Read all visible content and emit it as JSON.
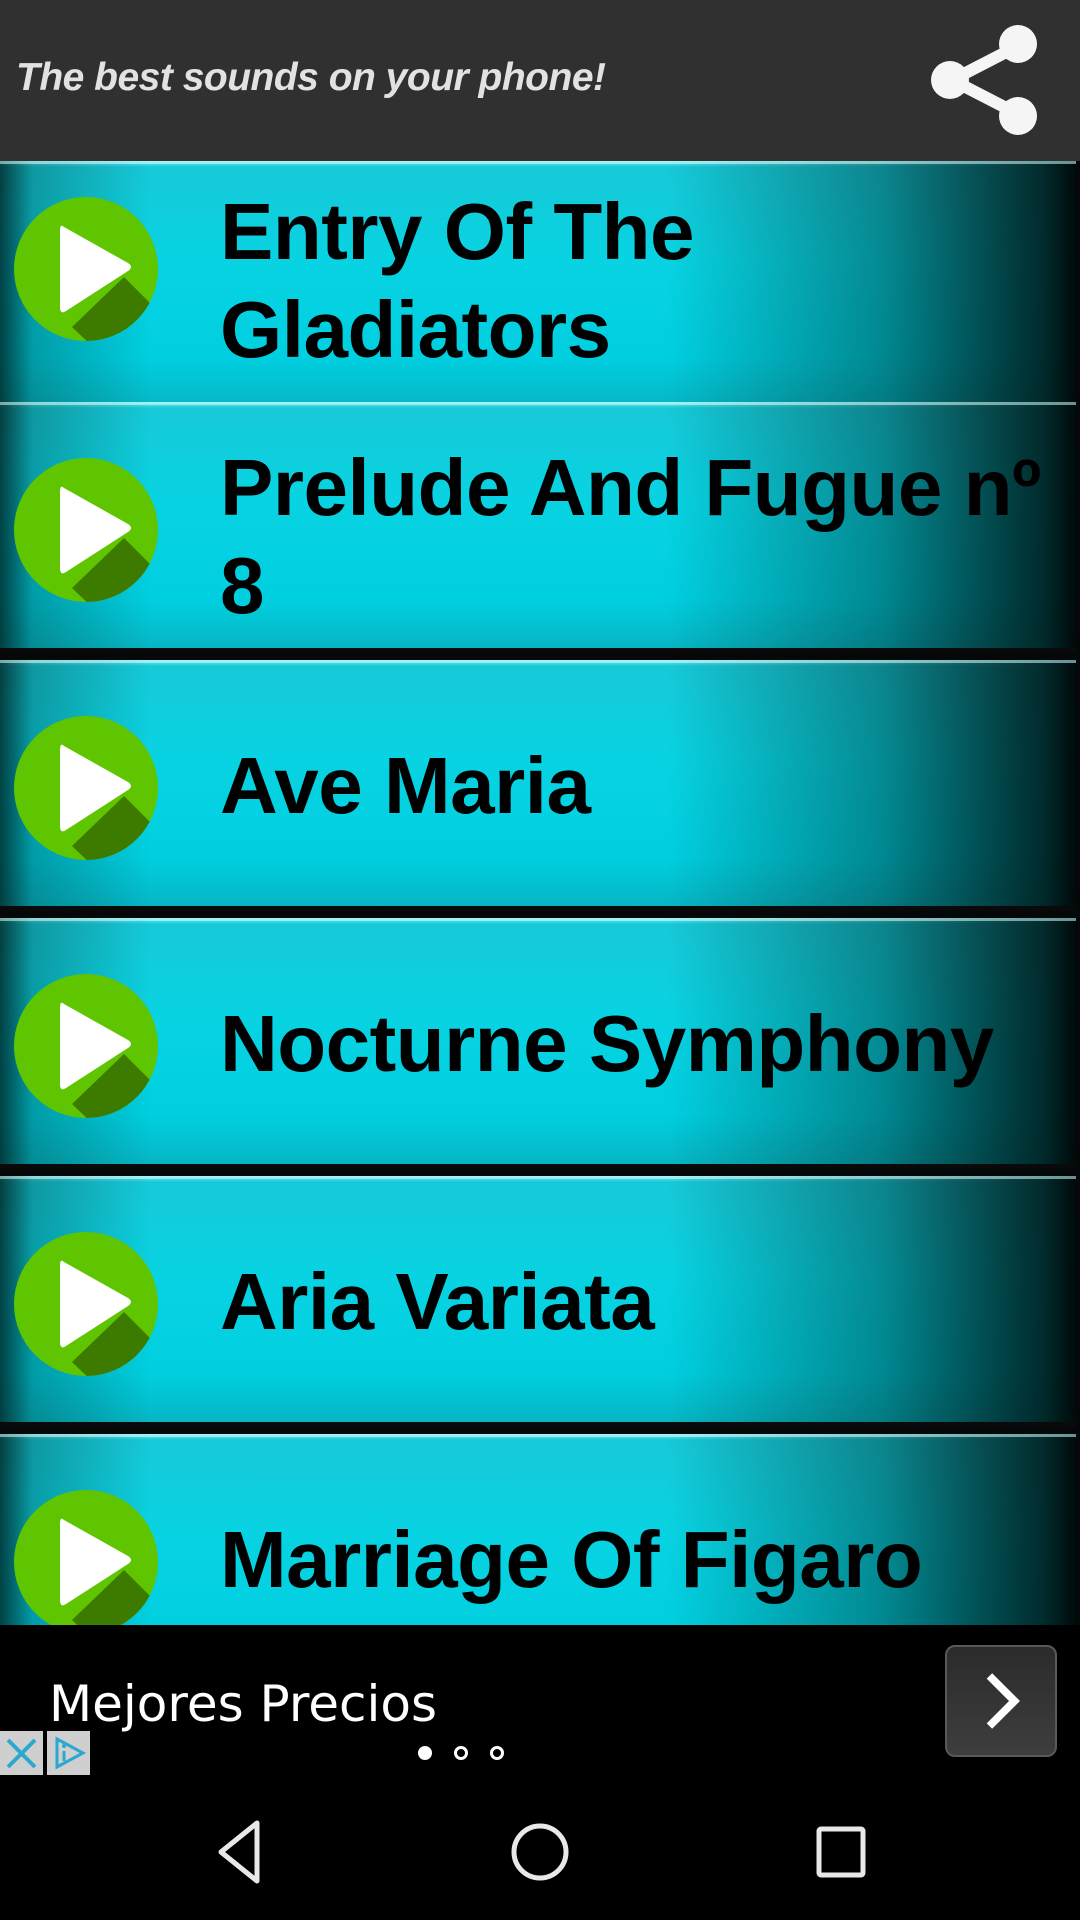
{
  "header": {
    "title": "The best sounds on your phone!",
    "share_icon": "share-icon"
  },
  "sounds": [
    {
      "title": "Entry Of The Gladiators",
      "icon": "play-icon"
    },
    {
      "title": "Prelude And Fugue nº 8",
      "icon": "play-icon"
    },
    {
      "title": "Ave Maria",
      "icon": "play-icon"
    },
    {
      "title": "Nocturne Symphony",
      "icon": "play-icon"
    },
    {
      "title": "Aria Variata",
      "icon": "play-icon"
    },
    {
      "title": "Marriage Of Figaro",
      "icon": "play-icon"
    }
  ],
  "ad": {
    "text": "Mejores Precios",
    "next_icon": "chevron-right-icon",
    "close_icon": "close-icon",
    "adchoices_icon": "adchoices-icon",
    "carousel_pages": 3,
    "carousel_active": 1
  },
  "navbar": {
    "back": "back-icon",
    "home": "home-icon",
    "recents": "recents-icon"
  },
  "colors": {
    "header_bg": "#303030",
    "row_cyan": "#00cfe0",
    "play_green": "#5fc500",
    "play_shadow": "#3c7a00"
  }
}
